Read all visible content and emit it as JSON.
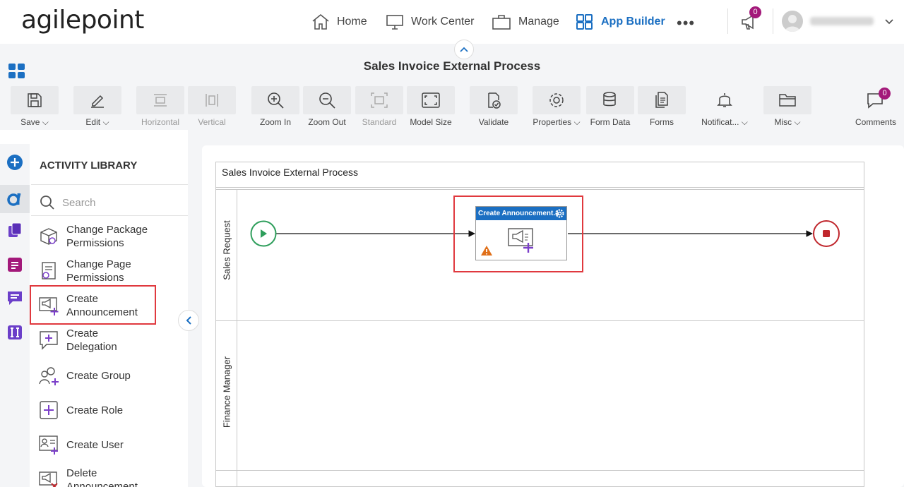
{
  "brand": {
    "logo_text": "agilepoint"
  },
  "nav": {
    "home": "Home",
    "work_center": "Work Center",
    "manage": "Manage",
    "app_builder": "App Builder",
    "more": "•••",
    "announcement_count": "0"
  },
  "header": {
    "title": "Sales Invoice External Process"
  },
  "toolbar": {
    "save": "Save",
    "edit": "Edit",
    "horizontal": "Horizontal",
    "vertical": "Vertical",
    "zoom_in": "Zoom In",
    "zoom_out": "Zoom Out",
    "standard": "Standard",
    "model_size": "Model Size",
    "validate": "Validate",
    "properties": "Properties",
    "form_data": "Form Data",
    "forms": "Forms",
    "notifications": "Notificat...",
    "misc": "Misc",
    "comments": "Comments",
    "comments_count": "0"
  },
  "library": {
    "title": "ACTIVITY LIBRARY",
    "search_placeholder": "Search",
    "items": [
      {
        "line1": "Change Package",
        "line2": "Permissions"
      },
      {
        "line1": "Change Page",
        "line2": "Permissions"
      },
      {
        "line1": "Create",
        "line2": "Announcement"
      },
      {
        "line1": "Create",
        "line2": "Delegation"
      },
      {
        "line1": "Create Group",
        "line2": ""
      },
      {
        "line1": "Create Role",
        "line2": ""
      },
      {
        "line1": "Create User",
        "line2": ""
      },
      {
        "line1": "Delete",
        "line2": "Announcement"
      }
    ]
  },
  "process": {
    "pool_title": "Sales Invoice External Process",
    "lanes": [
      "Sales Request",
      "Finance Manager"
    ],
    "task_title": "Create Announcement.1"
  },
  "colors": {
    "accent": "#1b6fc2",
    "highlight": "#e0393e",
    "start": "#2e9e5b",
    "end": "#c0272d",
    "badge": "#a3197a"
  }
}
